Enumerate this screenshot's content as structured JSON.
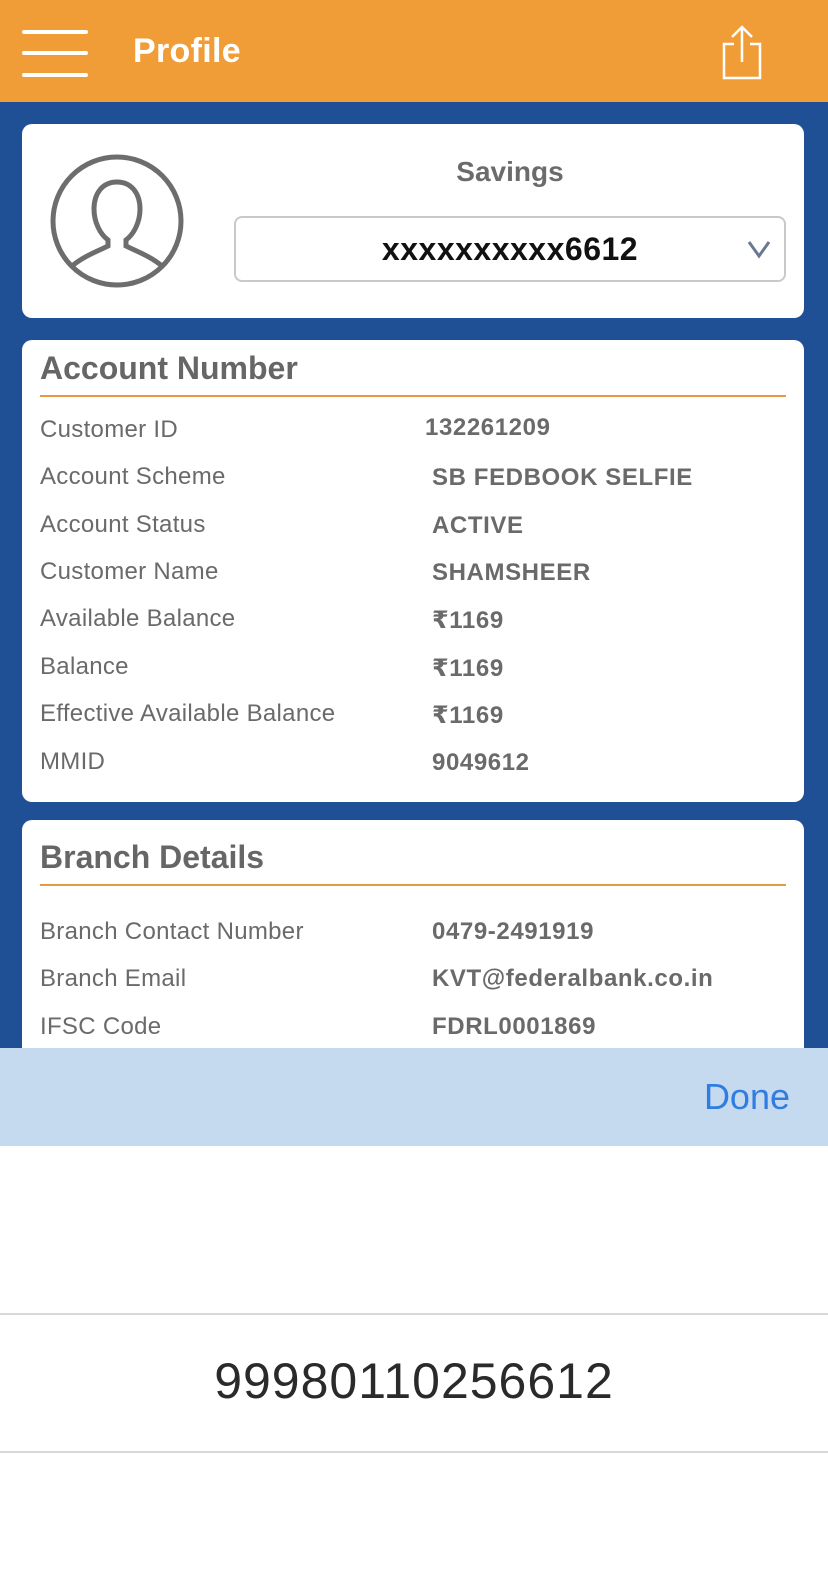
{
  "header": {
    "title": "Profile",
    "menu_icon": "hamburger-menu-icon",
    "share_icon": "share-icon"
  },
  "profile": {
    "account_type": "Savings",
    "selected_account": "xxxxxxxxxx6612"
  },
  "account_section": {
    "title": "Account Number",
    "rows": [
      {
        "label": "Customer ID",
        "value": "132261209"
      },
      {
        "label": "Account Scheme",
        "value": "SB FEDBOOK SELFIE"
      },
      {
        "label": "Account Status",
        "value": "ACTIVE"
      },
      {
        "label": "Customer Name",
        "value": "SHAMSHEER"
      },
      {
        "label": "Available Balance",
        "value": "₹1169"
      },
      {
        "label": "Balance",
        "value": "₹1169"
      },
      {
        "label": "Effective Available Balance",
        "value": "₹1169"
      },
      {
        "label": "MMID",
        "value": "9049612"
      }
    ]
  },
  "branch_section": {
    "title": "Branch Details",
    "rows": [
      {
        "label": "Branch Contact Number",
        "value": "0479-2491919"
      },
      {
        "label": "Branch Email",
        "value": "KVT@federalbank.co.in"
      },
      {
        "label": "IFSC Code",
        "value": "FDRL0001869"
      }
    ]
  },
  "picker": {
    "done_label": "Done",
    "selected_value": "99980110256612"
  },
  "colors": {
    "header": "#f09d38",
    "background": "#1f4f95",
    "accent_rule": "#e49a3d",
    "toolbar": "#c5d9ef",
    "done": "#2f7de1"
  }
}
